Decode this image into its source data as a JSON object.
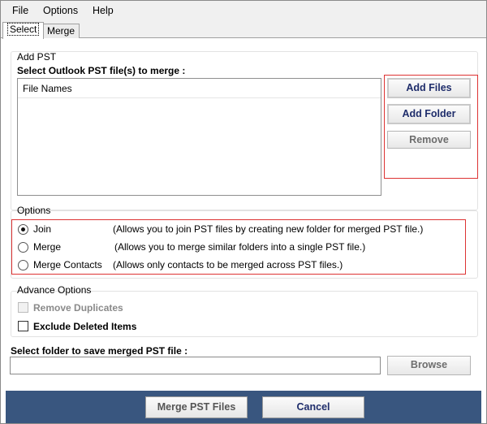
{
  "menu": [
    "File",
    "Options",
    "Help"
  ],
  "tabs": [
    "Select",
    "Merge"
  ],
  "add_pst": {
    "group_title": "Add PST",
    "instruction": "Select Outlook PST file(s) to merge :",
    "list_header": "File Names",
    "add_files": "Add Files",
    "add_folder": "Add Folder",
    "remove": "Remove"
  },
  "options": {
    "group_title": "Options",
    "items": [
      {
        "label": "Join",
        "desc": "(Allows you to join PST files by creating new folder for merged PST file.)",
        "checked": true
      },
      {
        "label": "Merge",
        "desc": "(Allows you to merge similar folders into a single PST file.)",
        "checked": false
      },
      {
        "label": "Merge Contacts",
        "desc": "(Allows only contacts to be merged across PST files.)",
        "checked": false
      }
    ]
  },
  "advance": {
    "group_title": "Advance Options",
    "remove_duplicates": "Remove Duplicates",
    "exclude_deleted": "Exclude Deleted Items"
  },
  "save": {
    "label": "Select folder to save merged PST file :",
    "value": "",
    "browse": "Browse"
  },
  "footer": {
    "merge_button": "Merge PST Files",
    "cancel_button": "Cancel"
  },
  "colors": {
    "accent_border": "#d33333",
    "footer_bg": "#39567f",
    "primary_text": "#1f2d6b"
  }
}
